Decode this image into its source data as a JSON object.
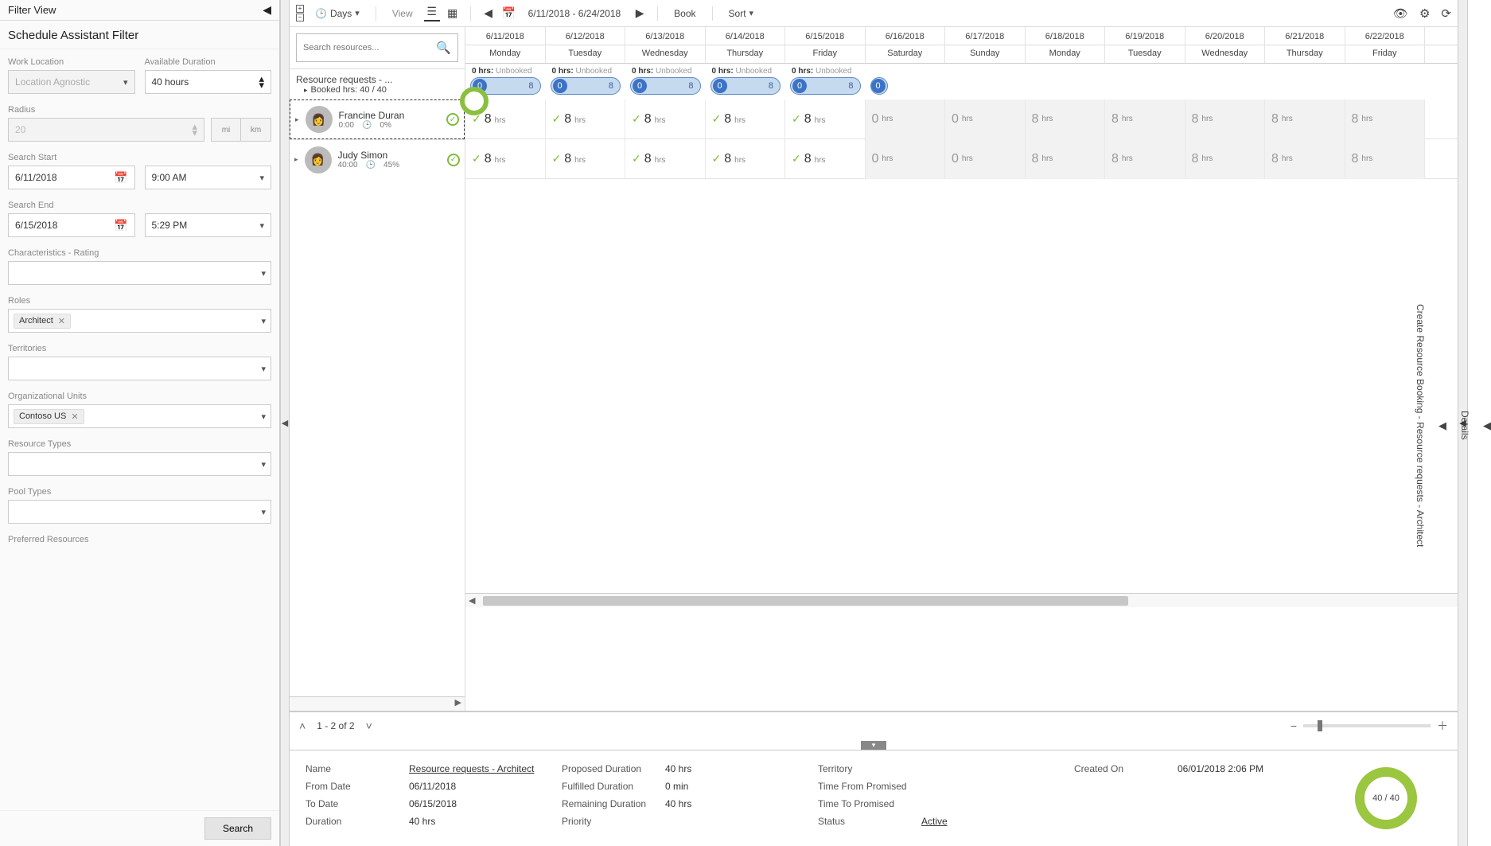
{
  "filter_view": {
    "title": "Filter View"
  },
  "schedule_filter": {
    "title": "Schedule Assistant Filter",
    "work_location": {
      "label": "Work Location",
      "value": "Location Agnostic"
    },
    "available_duration": {
      "label": "Available Duration",
      "value": "40 hours"
    },
    "radius": {
      "label": "Radius",
      "value": "20",
      "unit_mi": "mi",
      "unit_km": "km"
    },
    "search_start": {
      "label": "Search Start",
      "date": "6/11/2018",
      "time": "9:00 AM"
    },
    "search_end": {
      "label": "Search End",
      "date": "6/15/2018",
      "time": "5:29 PM"
    },
    "characteristics": {
      "label": "Characteristics - Rating"
    },
    "roles": {
      "label": "Roles",
      "tag": "Architect"
    },
    "territories": {
      "label": "Territories"
    },
    "org_units": {
      "label": "Organizational Units",
      "tag": "Contoso US"
    },
    "resource_types": {
      "label": "Resource Types"
    },
    "pool_types": {
      "label": "Pool Types"
    },
    "preferred": {
      "label": "Preferred Resources"
    },
    "search_btn": "Search"
  },
  "toolbar": {
    "days": "Days",
    "view": "View",
    "date_range": "6/11/2018 - 6/24/2018",
    "book": "Book",
    "sort": "Sort"
  },
  "search_placeholder": "Search resources...",
  "requirement": {
    "title": "Resource requests - ...",
    "booked": "Booked hrs: 40 / 40"
  },
  "dates": [
    {
      "d": "6/11/2018",
      "w": "Monday"
    },
    {
      "d": "6/12/2018",
      "w": "Tuesday"
    },
    {
      "d": "6/13/2018",
      "w": "Wednesday"
    },
    {
      "d": "6/14/2018",
      "w": "Thursday"
    },
    {
      "d": "6/15/2018",
      "w": "Friday"
    },
    {
      "d": "6/16/2018",
      "w": "Saturday"
    },
    {
      "d": "6/17/2018",
      "w": "Sunday"
    },
    {
      "d": "6/18/2018",
      "w": "Monday"
    },
    {
      "d": "6/19/2018",
      "w": "Tuesday"
    },
    {
      "d": "6/20/2018",
      "w": "Wednesday"
    },
    {
      "d": "6/21/2018",
      "w": "Thursday"
    },
    {
      "d": "6/22/2018",
      "w": "Friday"
    }
  ],
  "unbooked": {
    "prefix": "0 hrs:",
    "label": "Unbooked"
  },
  "pill": {
    "left": "0",
    "right": "8"
  },
  "resources": [
    {
      "name": "Francine Duran",
      "hrs": "0:00",
      "pct": "0%"
    },
    {
      "name": "Judy Simon",
      "hrs": "40:00",
      "pct": "45%"
    }
  ],
  "cells": {
    "avail8": "8",
    "zero": "0",
    "hrs": "hrs"
  },
  "pager": {
    "range": "1 - 2 of 2"
  },
  "right_rail": {
    "details": "Details",
    "create": "Create Resource Booking - Resource requests - Architect"
  },
  "bottom": {
    "name_label": "Name",
    "name_value": "Resource requests - Architect",
    "from_label": "From Date",
    "from_value": "06/11/2018",
    "to_label": "To Date",
    "to_value": "06/15/2018",
    "dur_label": "Duration",
    "dur_value": "40 hrs",
    "prop_label": "Proposed Duration",
    "prop_value": "40 hrs",
    "ful_label": "Fulfilled Duration",
    "ful_value": "0 min",
    "rem_label": "Remaining Duration",
    "rem_value": "40 hrs",
    "prio_label": "Priority",
    "prio_value": "",
    "terr_label": "Territory",
    "terr_value": "",
    "tfp_label": "Time From Promised",
    "tfp_value": "",
    "ttp_label": "Time To Promised",
    "ttp_value": "",
    "status_label": "Status",
    "status_value": "Active",
    "created_label": "Created On",
    "created_value": "06/01/2018 2:06 PM",
    "donut": "40 / 40"
  }
}
